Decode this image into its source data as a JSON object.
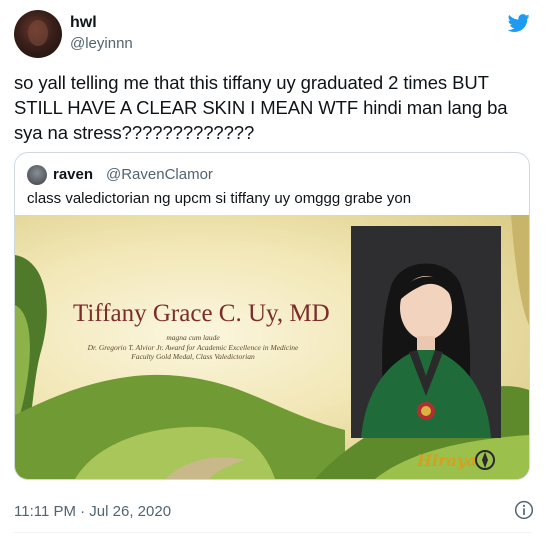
{
  "tweet": {
    "display_name": "hwl",
    "handle": "@leyinnn",
    "text": "so yall telling me that this tiffany uy graduated 2 times BUT STILL HAVE A CLEAR SKIN I MEAN WTF hindi man lang ba sya na stress?????????????",
    "timestamp": "11:11 PM · Jul 26, 2020"
  },
  "quote": {
    "display_name": "raven",
    "handle": "@RavenClamor",
    "text": "class valedictorian ng upcm si tiffany uy omggg grabe yon",
    "image": {
      "name": "Tiffany Grace C. Uy, MD",
      "award_lines": [
        "magna cum laude",
        "Dr. Gregorio T. Alvior Jr. Award for Academic Excellence in Medicine",
        "Faculty Gold Medal, Class Valedictorian"
      ],
      "logo_text": "Hiraya"
    }
  },
  "icons": {
    "brand": "twitter-bird-icon",
    "info": "info-icon"
  },
  "colors": {
    "twitter_blue": "#1d9bf0",
    "secondary_text": "#536471",
    "border": "#cfd9de"
  }
}
